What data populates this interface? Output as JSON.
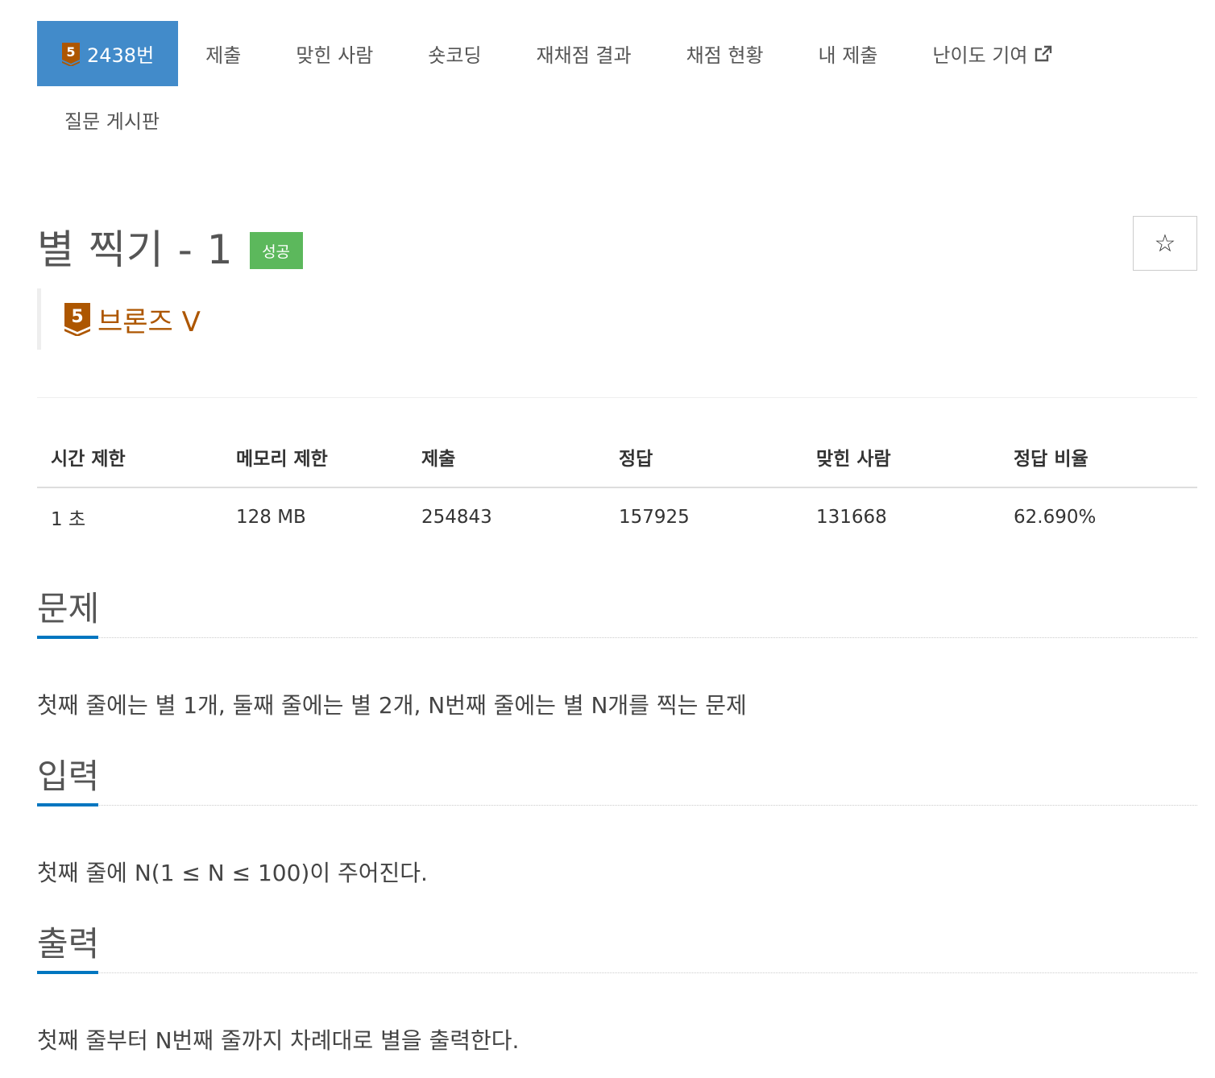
{
  "tabs": [
    {
      "label": "2438번",
      "active": true
    },
    {
      "label": "제출"
    },
    {
      "label": "맞힌 사람"
    },
    {
      "label": "숏코딩"
    },
    {
      "label": "재채점 결과"
    },
    {
      "label": "채점 현황"
    },
    {
      "label": "내 제출"
    },
    {
      "label": "난이도 기여"
    },
    {
      "label": "질문 게시판"
    }
  ],
  "tier_badge_text": "5",
  "problem": {
    "title": "별 찍기 - 1",
    "result_badge": "성공",
    "star_icon": "☆",
    "tier_label": "브론즈 V"
  },
  "info_table": {
    "headers": [
      "시간 제한",
      "메모리 제한",
      "제출",
      "정답",
      "맞힌 사람",
      "정답 비율"
    ],
    "values": [
      "1 초",
      "128 MB",
      "254843",
      "157925",
      "131668",
      "62.690%"
    ]
  },
  "sections": {
    "description": {
      "title": "문제",
      "text": "첫째 줄에는 별 1개, 둘째 줄에는 별 2개, N번째 줄에는 별 N개를 찍는 문제"
    },
    "input": {
      "title": "입력",
      "text": "첫째 줄에 N(1 ≤ N ≤ 100)이 주어진다."
    },
    "output": {
      "title": "출력",
      "text": "첫째 줄부터 N번째 줄까지 차례대로 별을 출력한다."
    }
  },
  "colors": {
    "active_tab": "#428bca",
    "success": "#5cb85c",
    "bronze": "#ad5600",
    "section_underline": "#0076c0"
  }
}
